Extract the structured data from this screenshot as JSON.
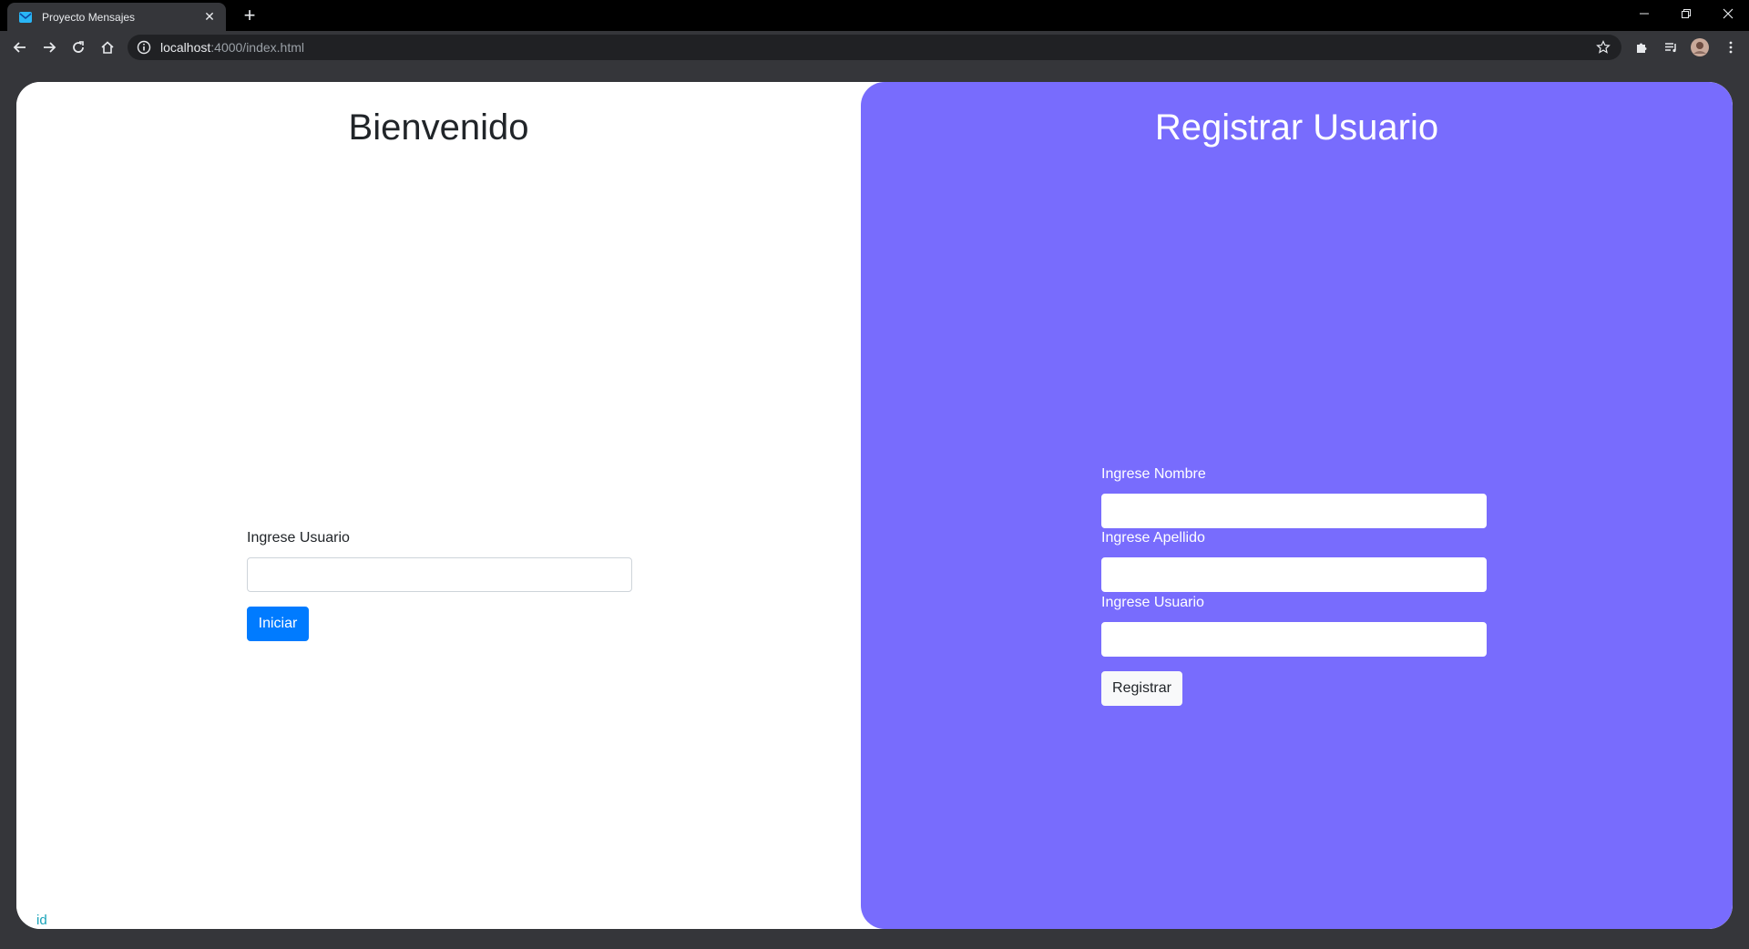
{
  "browser": {
    "tab_title": "Proyecto Mensajes",
    "tab_close": "✕",
    "new_tab": "+",
    "url_host": "localhost",
    "url_path": ":4000/index.html"
  },
  "login": {
    "title": "Bienvenido",
    "user_label": "Ingrese Usuario",
    "user_value": "",
    "submit_label": "Iniciar"
  },
  "register": {
    "title": "Registrar Usuario",
    "name_label": "Ingrese Nombre",
    "name_value": "",
    "surname_label": "Ingrese Apellido",
    "surname_value": "",
    "user_label": "Ingrese Usuario",
    "user_value": "",
    "submit_label": "Registrar"
  },
  "footer": {
    "id_text": "id"
  },
  "colors": {
    "register_bg": "#786cfd",
    "primary": "#007bff",
    "id_text": "#17a2b8"
  }
}
